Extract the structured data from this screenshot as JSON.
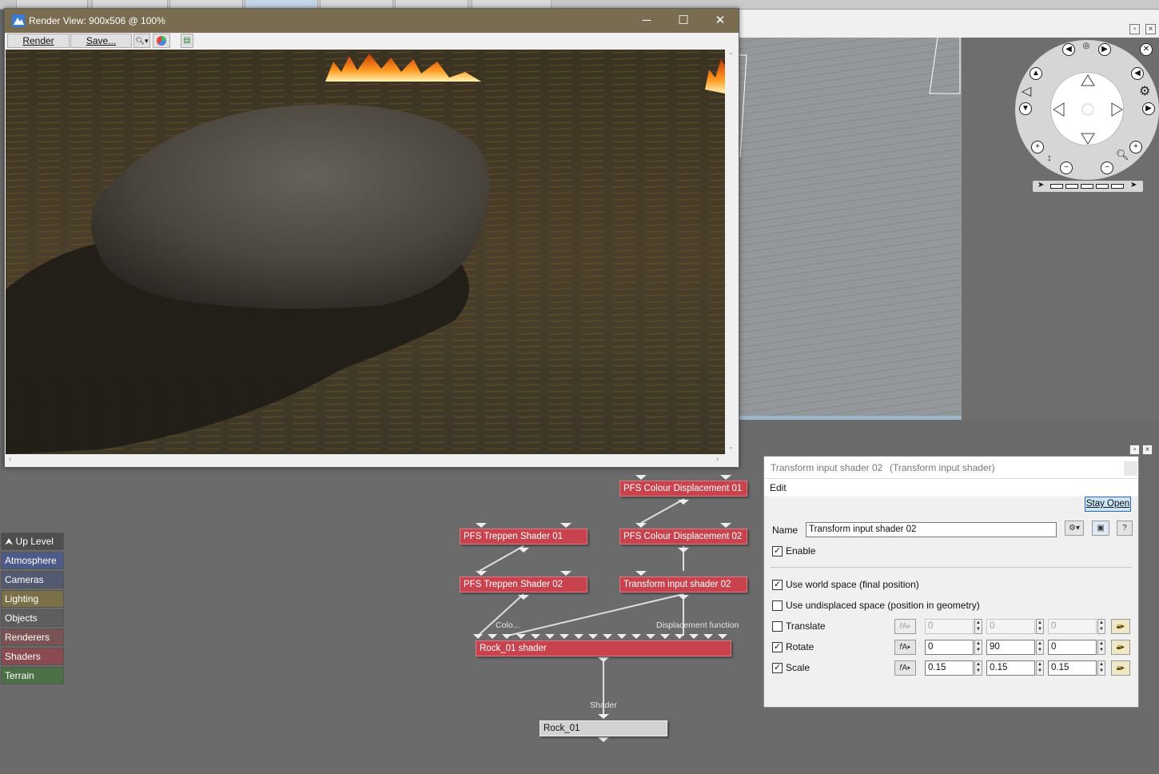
{
  "render_window": {
    "title": "Render View: 900x506 @ 100%",
    "render_label": "Render",
    "save_label": "Save..."
  },
  "nodes": {
    "colour_disp_01": "PFS Colour Displacement 01",
    "colour_disp_02": "PFS Colour Displacement 02",
    "treppen_01": "PFS Treppen Shader 01",
    "treppen_02": "PFS Treppen Shader 02",
    "transform_02": "Transform input shader 02",
    "rock_shader": "Rock_01 shader",
    "rock_object": "Rock_01",
    "port_colo": "Colo...",
    "port_displacement": "Displacement function",
    "port_shader": "Shader"
  },
  "categories": {
    "up_level": "Up Level",
    "items": [
      "Atmosphere",
      "Cameras",
      "Lighting",
      "Objects",
      "Renderers",
      "Shaders",
      "Terrain"
    ],
    "colors": [
      "#4d5a8a",
      "#525a72",
      "#7c7048",
      "#5e5e5e",
      "#7a5454",
      "#8a4a4f",
      "#4c7046"
    ]
  },
  "properties": {
    "header_name": "Transform input shader 02",
    "header_type": "(Transform input shader)",
    "menu_edit": "Edit",
    "stay_open": "Stay Open",
    "name_label": "Name",
    "name_value": "Transform input shader 02",
    "enable_label": "Enable",
    "world_space_label": "Use world space (final position)",
    "undisplaced_label": "Use undisplaced space (position in geometry)",
    "translate_label": "Translate",
    "rotate_label": "Rotate",
    "scale_label": "Scale",
    "translate": [
      "0",
      "0",
      "0"
    ],
    "rotate": [
      "0",
      "90",
      "0"
    ],
    "scale": [
      "0.15",
      "0.15",
      "0.15"
    ],
    "enable_checked": true,
    "world_space_checked": true,
    "undisplaced_checked": false,
    "translate_checked": false,
    "rotate_checked": true,
    "scale_checked": true
  },
  "icons": {
    "app": "terragen-logo-icon",
    "minimize": "minimize-icon",
    "maximize": "maximize-icon",
    "close": "close-icon",
    "zoom": "magnifier-icon",
    "colour": "colour-wheel-icon",
    "export": "export-icon"
  }
}
